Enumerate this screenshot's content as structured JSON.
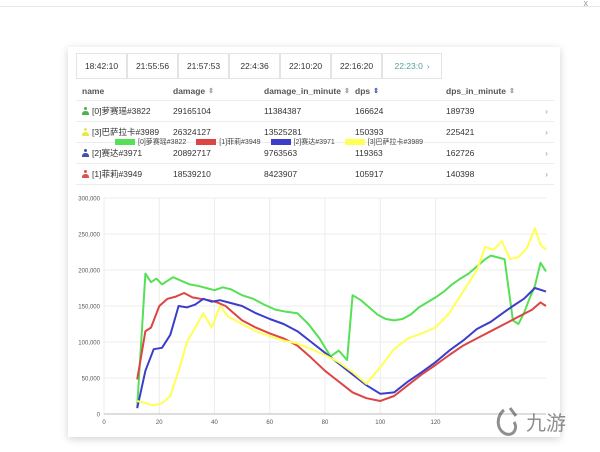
{
  "window": {
    "close_glyph": "x"
  },
  "tabs": [
    "18:42:10",
    "21:55:56",
    "21:57:53",
    "22:4:36",
    "22:10:20",
    "22:16:20",
    "22:23:0"
  ],
  "active_tab_index": 6,
  "table": {
    "headers": [
      "name",
      "damage",
      "damage_in_minute",
      "dps",
      "dps_in_minute"
    ],
    "rows": [
      {
        "name": "[0]萝赛瑶#3822",
        "damage": "29165104",
        "damage_in_minute": "11384387",
        "dps": "166624",
        "dps_in_minute": "189739",
        "icon_color": "#4caf50"
      },
      {
        "name": "[3]巴萨拉卡#3989",
        "damage": "26324127",
        "damage_in_minute": "13525281",
        "dps": "150393",
        "dps_in_minute": "225421",
        "icon_color": "#e8e84a"
      },
      {
        "name": "[2]赛达#3971",
        "damage": "20892717",
        "damage_in_minute": "9763563",
        "dps": "119363",
        "dps_in_minute": "162726",
        "icon_color": "#3f51b5"
      },
      {
        "name": "[1]菲莉#3949",
        "damage": "18539210",
        "damage_in_minute": "8423907",
        "dps": "105917",
        "dps_in_minute": "140398",
        "icon_color": "#e05050"
      }
    ]
  },
  "chart_data": {
    "type": "line",
    "legend_placement": "top",
    "grid": true,
    "xlim": [
      0,
      160
    ],
    "ylim": [
      0,
      300000
    ],
    "x_ticks": [
      0,
      20,
      40,
      60,
      80,
      100,
      120
    ],
    "y_ticks": [
      0,
      50000,
      100000,
      150000,
      200000,
      250000,
      300000
    ],
    "y_tick_labels": [
      "0",
      "50,000",
      "100,000",
      "150,000",
      "200,000",
      "250,000",
      "300,000"
    ],
    "series": [
      {
        "name": "[0]萝赛瑶#3822",
        "color": "#55e055",
        "x": [
          12,
          15,
          17,
          19,
          21,
          23,
          25,
          28,
          31,
          34,
          37,
          40,
          43,
          46,
          50,
          54,
          58,
          62,
          66,
          70,
          74,
          78,
          82,
          85,
          88,
          90,
          93,
          96,
          99,
          102,
          105,
          108,
          111,
          114,
          117,
          120,
          123,
          126,
          129,
          132,
          135,
          138,
          140,
          142,
          145,
          148,
          150,
          152,
          154,
          156,
          158,
          160
        ],
        "y": [
          10000,
          195000,
          183000,
          188000,
          180000,
          185000,
          190000,
          185000,
          180000,
          178000,
          175000,
          172000,
          176000,
          173000,
          165000,
          160000,
          152000,
          145000,
          142000,
          140000,
          125000,
          105000,
          80000,
          88000,
          75000,
          165000,
          158000,
          148000,
          138000,
          132000,
          130000,
          132000,
          138000,
          148000,
          155000,
          162000,
          170000,
          180000,
          188000,
          195000,
          205000,
          215000,
          220000,
          218000,
          215000,
          130000,
          125000,
          140000,
          160000,
          178000,
          210000,
          198000
        ]
      },
      {
        "name": "[1]菲莉#3949",
        "color": "#dd4444",
        "x": [
          12,
          15,
          17,
          20,
          23,
          26,
          29,
          32,
          35,
          38,
          41,
          44,
          47,
          50,
          55,
          60,
          65,
          70,
          75,
          80,
          85,
          90,
          95,
          100,
          105,
          110,
          115,
          120,
          125,
          130,
          135,
          140,
          145,
          150,
          155,
          158,
          160
        ],
        "y": [
          48000,
          115000,
          120000,
          150000,
          160000,
          163000,
          168000,
          162000,
          160000,
          158000,
          155000,
          150000,
          140000,
          130000,
          120000,
          112000,
          105000,
          95000,
          78000,
          60000,
          45000,
          30000,
          22000,
          18000,
          25000,
          40000,
          55000,
          68000,
          82000,
          95000,
          105000,
          115000,
          125000,
          135000,
          145000,
          155000,
          150000
        ]
      },
      {
        "name": "[2]赛达#3971",
        "color": "#3d3dcc",
        "x": [
          12,
          15,
          18,
          21,
          24,
          27,
          30,
          33,
          36,
          39,
          42,
          45,
          50,
          55,
          60,
          65,
          70,
          75,
          80,
          85,
          90,
          95,
          100,
          105,
          110,
          115,
          120,
          125,
          130,
          135,
          140,
          145,
          148,
          152,
          156,
          160
        ],
        "y": [
          8000,
          60000,
          90000,
          92000,
          110000,
          150000,
          148000,
          152000,
          160000,
          156000,
          158000,
          155000,
          150000,
          140000,
          132000,
          125000,
          115000,
          100000,
          85000,
          70000,
          55000,
          40000,
          28000,
          30000,
          45000,
          58000,
          72000,
          88000,
          102000,
          118000,
          128000,
          142000,
          150000,
          160000,
          175000,
          170000
        ]
      },
      {
        "name": "[3]巴萨拉卡#3989",
        "color": "#ffff55",
        "x": [
          12,
          15,
          18,
          21,
          24,
          27,
          30,
          33,
          36,
          39,
          42,
          45,
          50,
          55,
          60,
          65,
          70,
          75,
          80,
          85,
          90,
          95,
          100,
          105,
          110,
          115,
          120,
          125,
          130,
          135,
          138,
          141,
          144,
          147,
          150,
          153,
          156,
          158,
          160
        ],
        "y": [
          18000,
          15000,
          12000,
          15000,
          25000,
          60000,
          100000,
          120000,
          140000,
          120000,
          150000,
          135000,
          125000,
          115000,
          108000,
          102000,
          98000,
          90000,
          82000,
          72000,
          58000,
          42000,
          65000,
          90000,
          105000,
          112000,
          120000,
          140000,
          170000,
          200000,
          232000,
          228000,
          240000,
          215000,
          218000,
          230000,
          258000,
          235000,
          228000
        ]
      }
    ]
  }
}
